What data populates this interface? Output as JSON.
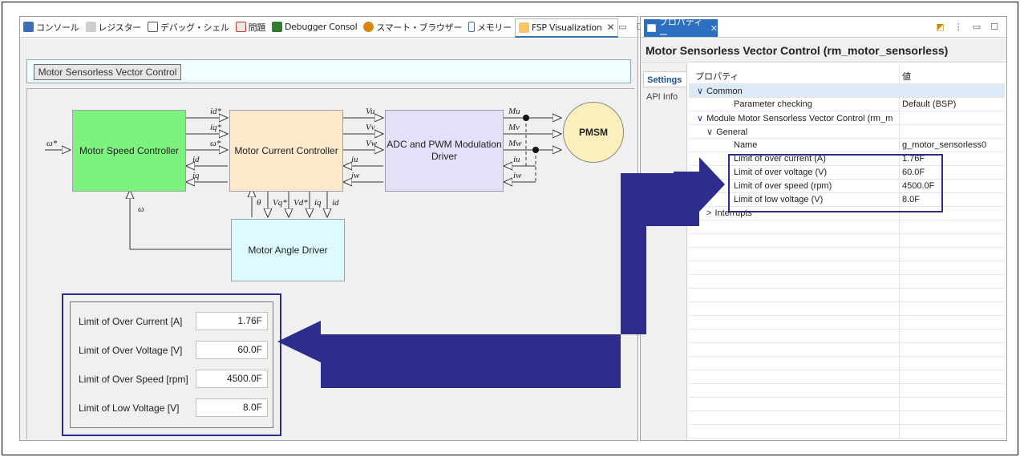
{
  "left_tabs": [
    {
      "label": "コンソール",
      "icon": "console-icon",
      "color": "#3d6fb6"
    },
    {
      "label": "レジスター",
      "icon": "registers-icon",
      "color": "#8a8a8a"
    },
    {
      "label": "デバッグ・シェル",
      "icon": "debug-shell-icon",
      "color": "#5b5b5b"
    },
    {
      "label": "問題",
      "icon": "problems-icon",
      "color": "#c0392b"
    },
    {
      "label": "Debugger Consol",
      "icon": "debugger-console-icon",
      "color": "#2e7d32"
    },
    {
      "label": "スマート・ブラウザー",
      "icon": "smart-browser-icon",
      "color": "#d68910"
    },
    {
      "label": "メモリー",
      "icon": "memory-icon",
      "color": "#3d6fb6"
    },
    {
      "label": "FSP Visualization",
      "icon": "fsp-visualization-icon",
      "color": "#d68910",
      "active": true
    }
  ],
  "viz": {
    "title_button": "Motor Sensorless Vector Control",
    "blocks": {
      "speed": "Motor Speed Controller",
      "current": "Motor Current Controller",
      "adc": "ADC and PWM Modulation Driver",
      "pmsm": "PMSM",
      "angle": "Motor Angle Driver"
    },
    "signals": {
      "omega_star": "ω*",
      "id_star": "id*",
      "iq_star": "iq*",
      "omega_star2": "ω*",
      "id": "id",
      "iq": "iq",
      "vu": "Vu",
      "vv": "Vv",
      "vw": "Vw",
      "iu": "iu",
      "iw": "iw",
      "mu": "Mu",
      "mv": "Mv",
      "mw": "Mw",
      "iu2": "iu",
      "iw2": "iw",
      "omega": "ω",
      "theta": "θ",
      "vq_star": "Vq*",
      "vd_star": "Vd*",
      "iq2": "iq",
      "id2": "id"
    }
  },
  "limits": [
    {
      "label": "Limit of Over Current [A]",
      "value": "1.76F"
    },
    {
      "label": "Limit of Over Voltage [V]",
      "value": "60.0F"
    },
    {
      "label": "Limit of Over Speed [rpm]",
      "value": "4500.0F"
    },
    {
      "label": "Limit of Low Voltage [V]",
      "value": "8.0F"
    }
  ],
  "properties": {
    "tab_label": "プロパティー",
    "header": "Motor Sensorless Vector Control (rm_motor_sensorless)",
    "side_tabs": [
      "Settings",
      "API Info"
    ],
    "col_property": "プロパティ",
    "col_value": "値",
    "rows": [
      {
        "key": "Common",
        "value": "",
        "indent": 0,
        "toggle": "∨"
      },
      {
        "key": "Parameter checking",
        "value": "Default (BSP)",
        "indent": 2,
        "toggle": ""
      },
      {
        "key": "Module Motor Sensorless Vector Control (rm_m",
        "value": "",
        "indent": 0,
        "toggle": "∨"
      },
      {
        "key": "General",
        "value": "",
        "indent": 1,
        "toggle": "∨"
      },
      {
        "key": "Name",
        "value": "g_motor_sensorless0",
        "indent": 2,
        "toggle": ""
      },
      {
        "key": "Limit of over current (A)",
        "value": "1.76F",
        "indent": 2,
        "toggle": ""
      },
      {
        "key": "Limit of over voltage (V)",
        "value": "60.0F",
        "indent": 2,
        "toggle": ""
      },
      {
        "key": "Limit of over speed (rpm)",
        "value": "4500.0F",
        "indent": 2,
        "toggle": ""
      },
      {
        "key": "Limit of low voltage (V)",
        "value": "8.0F",
        "indent": 2,
        "toggle": ""
      },
      {
        "key": "Interrupts",
        "value": "",
        "indent": 1,
        "toggle": ">"
      }
    ]
  },
  "colors": {
    "speed_block": "#7ef27e",
    "current_block": "#fde9cc",
    "adc_block": "#e4e0f8",
    "pmsm_block": "#fbf0bc",
    "angle_block": "#dcfaff",
    "highlight": "#2d2d8c",
    "arrow": "#2d2d8c"
  }
}
